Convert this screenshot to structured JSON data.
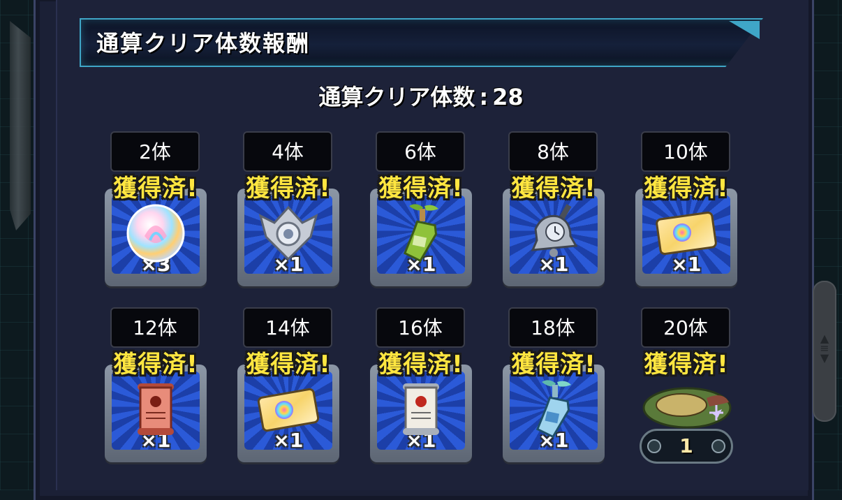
{
  "header": {
    "title": "通算クリア体数報酬"
  },
  "progress": {
    "label": "通算クリア体数",
    "separator": ":",
    "value": "28"
  },
  "claimed_label": "獲得済!",
  "rewards": [
    {
      "count": "2体",
      "qty": "×3",
      "icon": "rainbow-orb-icon"
    },
    {
      "count": "4体",
      "qty": "×1",
      "icon": "silver-emblem-icon"
    },
    {
      "count": "6体",
      "qty": "×1",
      "icon": "sprout-bottle-icon"
    },
    {
      "count": "8体",
      "qty": "×1",
      "icon": "bell-clock-icon"
    },
    {
      "count": "10体",
      "qty": "×1",
      "icon": "rainbow-ticket-icon"
    },
    {
      "count": "12体",
      "qty": "×1",
      "icon": "red-scroll-icon"
    },
    {
      "count": "14体",
      "qty": "×1",
      "icon": "rainbow-ticket-icon"
    },
    {
      "count": "16体",
      "qty": "×1",
      "icon": "white-scroll-icon"
    },
    {
      "count": "18体",
      "qty": "×1",
      "icon": "el-bottle-icon"
    },
    {
      "count": "20体",
      "qty": "1",
      "icon": "special-reward-icon"
    }
  ],
  "colors": {
    "banner_border": "#3fa6c7",
    "claimed_text": "#ffe640",
    "card_bg": "#2b5ad8",
    "panel_bg": "#1d2239"
  }
}
